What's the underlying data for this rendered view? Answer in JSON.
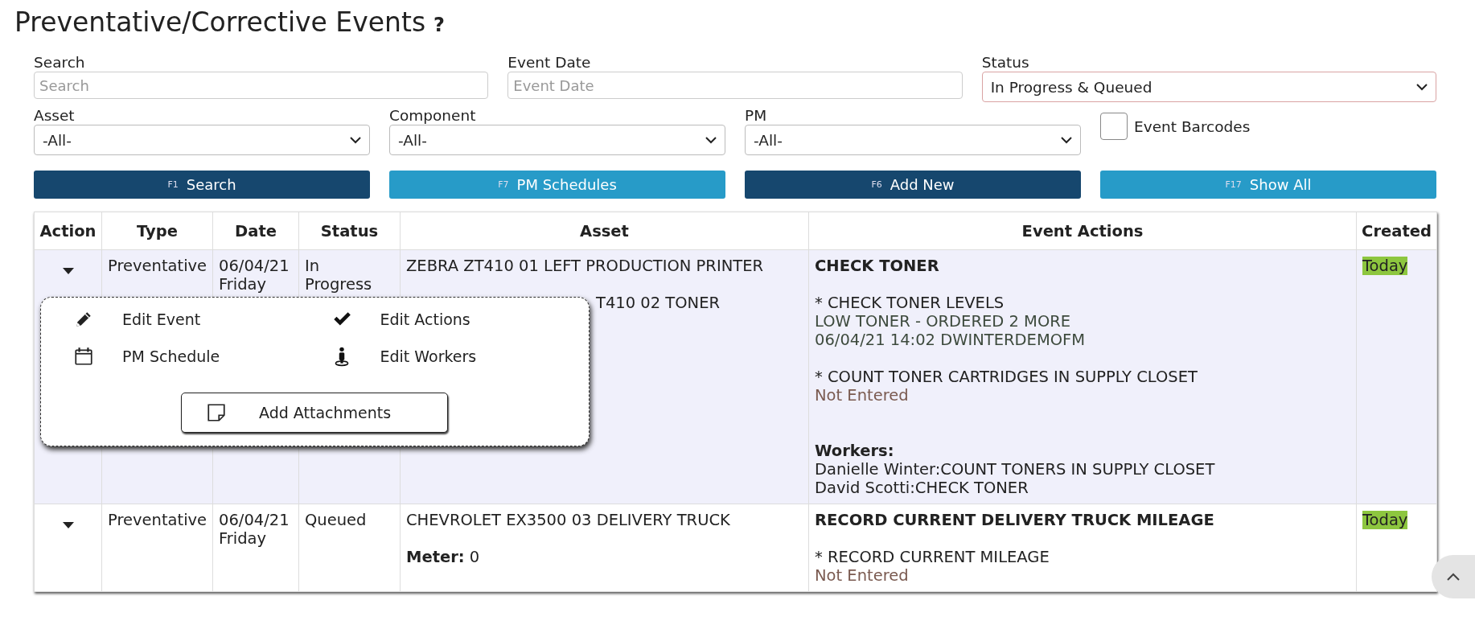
{
  "page": {
    "title": "Preventative/Corrective Events",
    "help": "?"
  },
  "filters": [
    {
      "kind": "text",
      "label": "Search",
      "placeholder": "Search",
      "alert": false
    },
    {
      "kind": "text",
      "label": "Event Date",
      "placeholder": "Event Date",
      "alert": false
    },
    {
      "kind": "select",
      "label": "Status",
      "value": "In Progress & Queued",
      "alert": true
    },
    {
      "kind": "select",
      "label": "Asset",
      "value": "-All-",
      "alert": false
    },
    {
      "kind": "select",
      "label": "Component",
      "value": "-All-",
      "alert": false
    },
    {
      "kind": "select",
      "label": "PM",
      "value": "-All-",
      "alert": false
    },
    {
      "kind": "checkbox",
      "label": "Event Barcodes",
      "checked": false
    }
  ],
  "buttons": [
    {
      "key": "F1",
      "label": "Search"
    },
    {
      "key": "F7",
      "label": "PM Schedules"
    },
    {
      "key": "F6",
      "label": "Add New"
    },
    {
      "key": "F17",
      "label": "Show All"
    }
  ],
  "table": {
    "columns": [
      "Action",
      "Type",
      "Date",
      "Status",
      "Asset",
      "Event Actions",
      "Created"
    ],
    "rows": [
      {
        "highlighted": true,
        "type": "Preventative",
        "date": "06/04/21",
        "day": "Friday",
        "status": "In Progress",
        "asset": "ZEBRA ZT410 01 LEFT PRODUCTION PRINTER",
        "details": [
          {
            "value": "T410 02 TONER"
          }
        ],
        "event_title": "CHECK TONER",
        "actions": [
          {
            "name": "* CHECK TONER LEVELS",
            "entered": true,
            "notes": [
              "LOW TONER - ORDERED 2 MORE",
              "06/04/21 14:02 DWINTERDEMOFM"
            ]
          },
          {
            "name": "* COUNT TONER CARTRIDGES IN SUPPLY CLOSET",
            "entered": false,
            "notes": [
              "Not Entered"
            ]
          }
        ],
        "workers_label": "Workers:",
        "workers": [
          "Danielle Winter:COUNT TONERS IN SUPPLY CLOSET",
          "David Scotti:CHECK TONER"
        ],
        "created": "Today"
      },
      {
        "highlighted": false,
        "type": "Preventative",
        "date": "06/04/21",
        "day": "Friday",
        "status": "Queued",
        "asset": "CHEVROLET EX3500 03 DELIVERY TRUCK",
        "details": [
          {
            "label": "Meter:",
            "value": "0"
          }
        ],
        "event_title": "RECORD CURRENT DELIVERY TRUCK MILEAGE",
        "actions": [
          {
            "name": "* RECORD CURRENT MILEAGE",
            "entered": false,
            "notes": [
              "Not Entered"
            ]
          }
        ],
        "created": "Today"
      }
    ]
  },
  "action_menu": {
    "items": [
      {
        "label": "Edit Event"
      },
      {
        "label": "Edit Actions"
      },
      {
        "label": "PM Schedule"
      },
      {
        "label": "Edit Workers"
      }
    ],
    "attach": {
      "label": "Add Attachments"
    }
  }
}
